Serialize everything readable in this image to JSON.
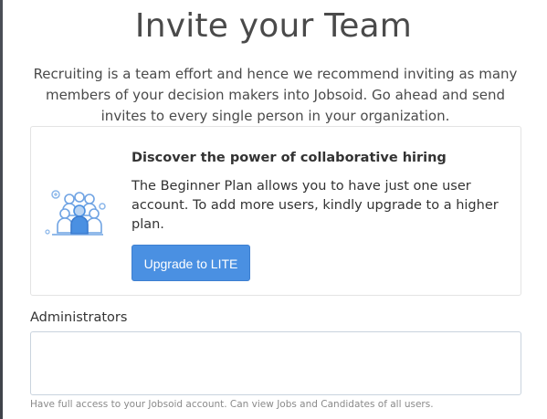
{
  "page": {
    "title": "Invite your Team",
    "intro": "Recruiting is a team effort and hence we recommend inviting as many members of your decision makers into Jobsoid. Go ahead and send invites to every single person in your organization."
  },
  "promo_card": {
    "icon": "team-icon",
    "heading": "Discover the power of collaborative hiring",
    "body": "The Beginner Plan allows you to have just one user account. To add more users, kindly upgrade to a higher plan.",
    "button_label": "Upgrade to LITE"
  },
  "administrators": {
    "label": "Administrators",
    "value": "",
    "help": "Have full access to your Jobsoid account. Can view Jobs and Candidates of all users."
  },
  "colors": {
    "primary_button": "#4a90e2",
    "icon_light": "#b9d4f3",
    "icon_dark": "#4a90e2"
  }
}
